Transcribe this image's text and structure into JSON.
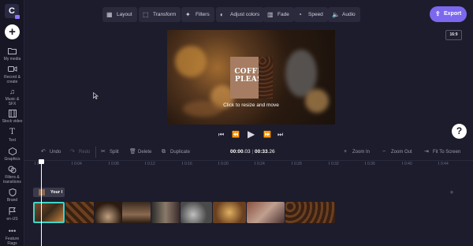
{
  "sidebar": {
    "logo": "C",
    "add_button": "+",
    "items": [
      {
        "label": "My media",
        "icon": "folder-icon"
      },
      {
        "label": "Record &",
        "label2": "create",
        "icon": "camera-icon"
      },
      {
        "label": "Music &",
        "label2": "SFX",
        "icon": "music-icon"
      },
      {
        "label": "Stock video",
        "icon": "film-icon"
      },
      {
        "label": "Text",
        "icon": "text-icon"
      },
      {
        "label": "Graphics",
        "icon": "shapes-icon"
      },
      {
        "label": "Filters &",
        "label2": "transitions",
        "icon": "filters-icon"
      },
      {
        "label": "Brand",
        "icon": "shield-icon"
      },
      {
        "label": "en-US",
        "icon": "flag-icon"
      },
      {
        "label": "Feature",
        "label2": "Flags",
        "icon": "more-icon"
      }
    ]
  },
  "toolbar": {
    "layout": "Layout",
    "transform": "Transform",
    "filters": "Filters",
    "adjust_colors": "Adjust colors",
    "fade": "Fade",
    "speed": "Speed",
    "audio": "Audio",
    "export": "Export",
    "aspect_ratio": "16:9"
  },
  "preview": {
    "poster_text_line1": "COFFEE",
    "poster_text_line2": "PLEASE",
    "hint": "Click to resize and move"
  },
  "edit_toolbar": {
    "undo": "Undo",
    "redo": "Redo",
    "split": "Split",
    "delete": "Delete",
    "duplicate": "Duplicate",
    "time_current": "00:00",
    "time_current_frac": ".03",
    "time_sep": "|",
    "time_total": "00:33",
    "time_total_frac": ".26",
    "zoom_in": "Zoom In",
    "zoom_out": "Zoom Out",
    "fit": "Fit To Screen"
  },
  "timeline": {
    "ticks": [
      "0",
      "0:04",
      "0:08",
      "0:12",
      "0:16",
      "0:20",
      "0:24",
      "0:28",
      "0:32",
      "0:36",
      "0:40",
      "0:44"
    ],
    "text_track_label": "Your l"
  },
  "colors": {
    "accent": "#7b68ee",
    "selected_clip": "#3fd6c8",
    "background": "#1c1c2c"
  }
}
